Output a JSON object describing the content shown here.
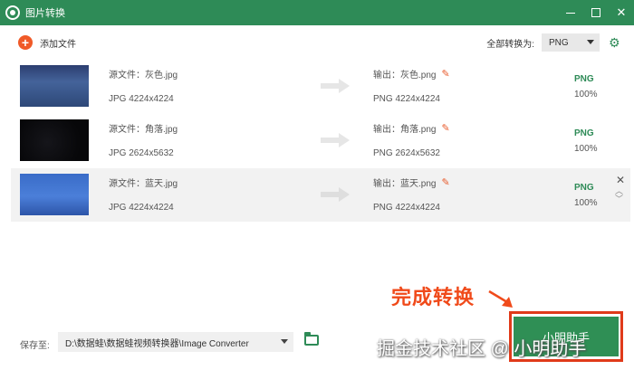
{
  "app": {
    "title": "图片转换"
  },
  "toolbar": {
    "add_label": "添加文件",
    "convert_all_label": "全部转换为:",
    "convert_all_value": "PNG"
  },
  "files": [
    {
      "src_name": "源文件：灰色.jpg",
      "src_meta": "JPG   4224x4224",
      "out_name": "输出：灰色.png",
      "out_meta": "PNG   4224x4224",
      "format": "PNG",
      "progress_text": "100%"
    },
    {
      "src_name": "源文件：角落.jpg",
      "src_meta": "JPG   2624x5632",
      "out_name": "输出：角落.png",
      "out_meta": "PNG   2624x5632",
      "format": "PNG",
      "progress_text": "100%"
    },
    {
      "src_name": "源文件：蓝天.jpg",
      "src_meta": "JPG   4224x4224",
      "out_name": "输出：蓝天.png",
      "out_meta": "PNG   4224x4224",
      "format": "PNG",
      "progress_text": "100%"
    }
  ],
  "footer": {
    "save_label": "保存至:",
    "save_path": "D:\\数据蛙\\数据蛙视频转换器\\Image Converter",
    "convert_button": "小明助手"
  },
  "annotation": {
    "text": "完成转换"
  },
  "watermark": {
    "text": "掘金技术社区 @ 小明助手"
  },
  "colors": {
    "brand": "#2e8b57",
    "accent": "#f05a28",
    "annotation": "#e03a1a"
  }
}
